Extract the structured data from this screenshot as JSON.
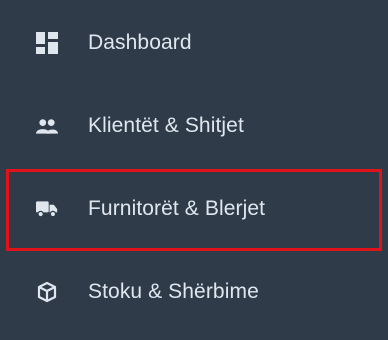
{
  "sidebar": {
    "items": [
      {
        "label": "Dashboard",
        "icon": "dashboard-icon"
      },
      {
        "label": "Klientët & Shitjet",
        "icon": "users-icon"
      },
      {
        "label": "Furnitorët & Blerjet",
        "icon": "truck-icon"
      },
      {
        "label": "Stoku & Shërbime",
        "icon": "cube-icon"
      }
    ],
    "highlighted_item": "Furnitorët & Blerjet"
  },
  "colors": {
    "background": "#2f3b49",
    "text": "#dfe6ee",
    "highlight": "#e0131a"
  }
}
